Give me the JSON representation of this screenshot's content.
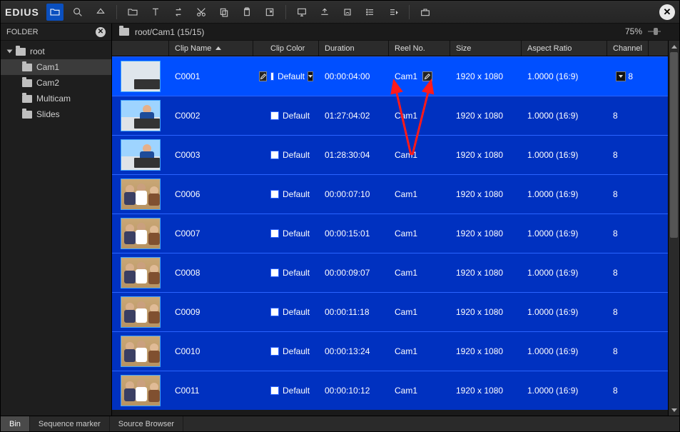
{
  "brand": "EDIUS",
  "folder_panel": {
    "title": "FOLDER"
  },
  "tree": {
    "root_label": "root",
    "items": [
      {
        "label": "Cam1",
        "selected": true
      },
      {
        "label": "Cam2"
      },
      {
        "label": "Multicam"
      },
      {
        "label": "Slides"
      }
    ]
  },
  "path": {
    "text": "root/Cam1 (15/15)"
  },
  "zoom": {
    "text": "75%"
  },
  "columns": {
    "name": "Clip Name",
    "color": "Clip Color",
    "duration": "Duration",
    "reel": "Reel No.",
    "size": "Size",
    "aspect": "Aspect Ratio",
    "channel": "Channel"
  },
  "clips": [
    {
      "name": "C0001",
      "color": "Default",
      "duration": "00:00:04:00",
      "reel": "Cam1",
      "size": "1920 x 1080",
      "aspect": "1.0000 (16:9)",
      "channel": "8",
      "selected": true,
      "thumb": "plain"
    },
    {
      "name": "C0002",
      "color": "Default",
      "duration": "01:27:04:02",
      "reel": "Cam1",
      "size": "1920 x 1080",
      "aspect": "1.0000 (16:9)",
      "channel": "8",
      "selected": false,
      "thumb": "speak"
    },
    {
      "name": "C0003",
      "color": "Default",
      "duration": "01:28:30:04",
      "reel": "Cam1",
      "size": "1920 x 1080",
      "aspect": "1.0000 (16:9)",
      "channel": "8",
      "selected": false,
      "thumb": "speak"
    },
    {
      "name": "C0006",
      "color": "Default",
      "duration": "00:00:07:10",
      "reel": "Cam1",
      "size": "1920 x 1080",
      "aspect": "1.0000 (16:9)",
      "channel": "8",
      "selected": false,
      "thumb": "room"
    },
    {
      "name": "C0007",
      "color": "Default",
      "duration": "00:00:15:01",
      "reel": "Cam1",
      "size": "1920 x 1080",
      "aspect": "1.0000 (16:9)",
      "channel": "8",
      "selected": false,
      "thumb": "room"
    },
    {
      "name": "C0008",
      "color": "Default",
      "duration": "00:00:09:07",
      "reel": "Cam1",
      "size": "1920 x 1080",
      "aspect": "1.0000 (16:9)",
      "channel": "8",
      "selected": false,
      "thumb": "room"
    },
    {
      "name": "C0009",
      "color": "Default",
      "duration": "00:00:11:18",
      "reel": "Cam1",
      "size": "1920 x 1080",
      "aspect": "1.0000 (16:9)",
      "channel": "8",
      "selected": false,
      "thumb": "room"
    },
    {
      "name": "C0010",
      "color": "Default",
      "duration": "00:00:13:24",
      "reel": "Cam1",
      "size": "1920 x 1080",
      "aspect": "1.0000 (16:9)",
      "channel": "8",
      "selected": false,
      "thumb": "room"
    },
    {
      "name": "C0011",
      "color": "Default",
      "duration": "00:00:10:12",
      "reel": "Cam1",
      "size": "1920 x 1080",
      "aspect": "1.0000 (16:9)",
      "channel": "8",
      "selected": false,
      "thumb": "room"
    }
  ],
  "bottom_tabs": [
    {
      "label": "Bin",
      "active": true
    },
    {
      "label": "Sequence marker"
    },
    {
      "label": "Source Browser"
    }
  ]
}
